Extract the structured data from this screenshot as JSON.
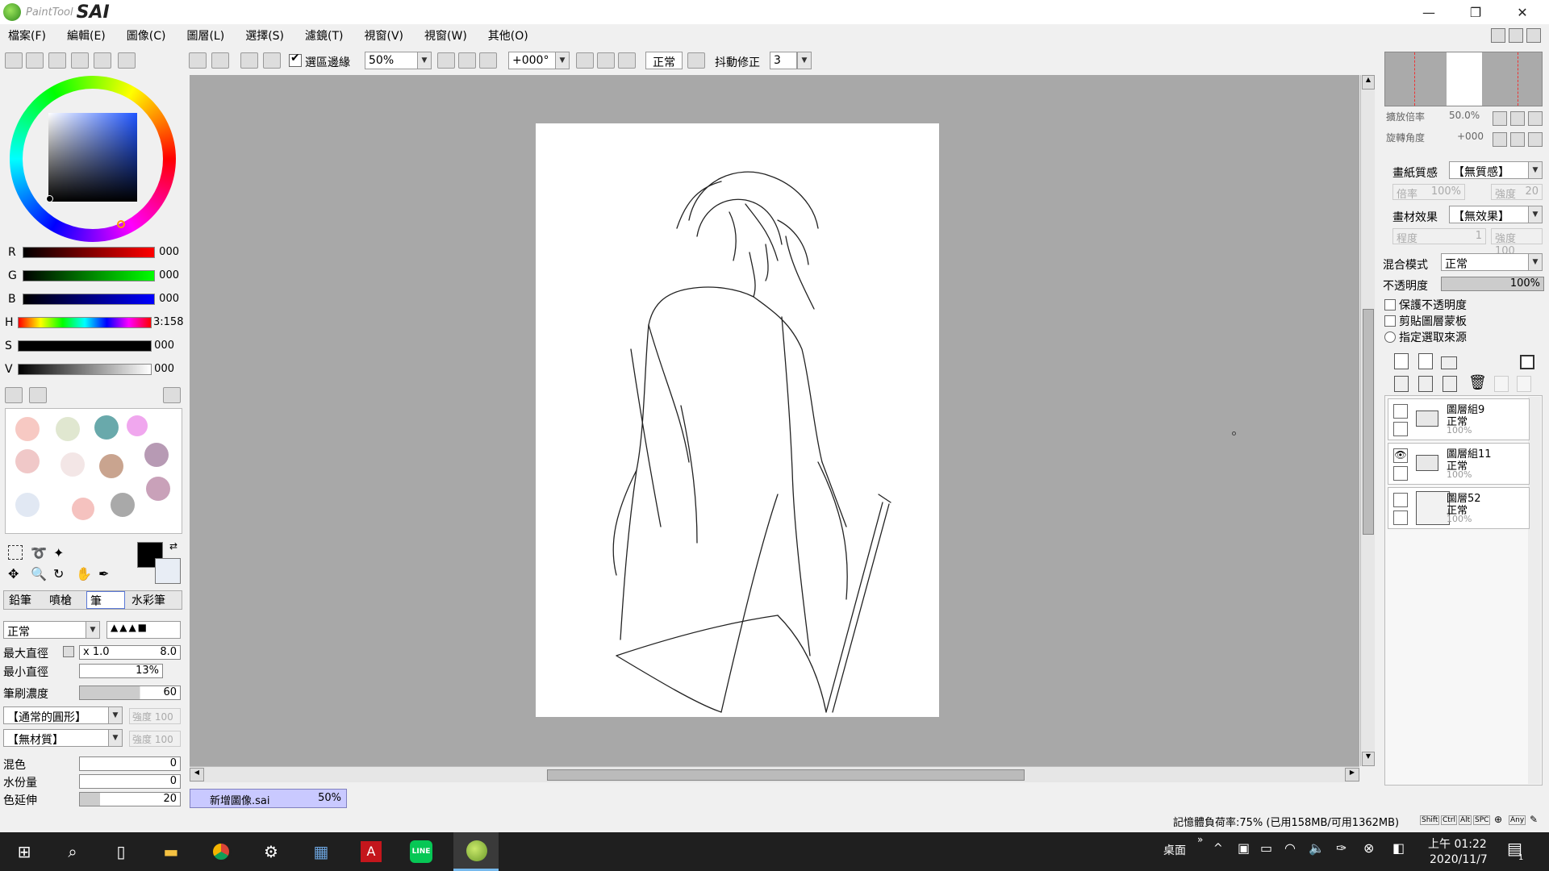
{
  "app": {
    "title_small": "PaintTool",
    "title_big": "SAI"
  },
  "window_controls": {
    "minimize": "—",
    "restore": "❐",
    "close": "✕"
  },
  "menu": [
    "檔案(F)",
    "編輯(E)",
    "圖像(C)",
    "圖層(L)",
    "選擇(S)",
    "濾鏡(T)",
    "視窗(V)",
    "視窗(W)",
    "其他(O)"
  ],
  "toolbar": {
    "selection_edge_label": "選區邊緣",
    "zoom": "50%",
    "rotation": "+000°",
    "blend_mode": "正常",
    "stabilizer_label": "抖動修正",
    "stabilizer_value": "3"
  },
  "color": {
    "r_label": "R",
    "r_value": "000",
    "g_label": "G",
    "g_value": "000",
    "b_label": "B",
    "b_value": "000",
    "h_label": "H",
    "h_value": "3:158",
    "s_label": "S",
    "s_value": "000",
    "v_label": "V",
    "v_value": "000"
  },
  "swatches": [
    "#f7c9c3",
    "#e0e7d0",
    "#69a9ab",
    "#f0a7ee",
    "#f0c8c8",
    "#f3e6e6",
    "#c9a48f",
    "#b79ab4",
    "#e1e8f3",
    "#f5c2bf",
    "#a9a9a9",
    "#c9a1b9"
  ],
  "brush_tabs": [
    "鉛筆",
    "噴槍",
    "筆",
    "水彩筆"
  ],
  "brush": {
    "blend": "正常",
    "max_size_label": "最大直徑",
    "max_size_mult": "x 1.0",
    "max_size_value": "8.0",
    "min_size_label": "最小直徑",
    "min_size_value": "13%",
    "density_label": "筆刷濃度",
    "density_value": "60",
    "shape": "【通常的圓形】",
    "shape_strength": "強度 100",
    "texture": "【無材質】",
    "texture_strength": "強度 100",
    "mix_label": "混色",
    "mix_value": "0",
    "water_label": "水份量",
    "water_value": "0",
    "stretch_label": "色延伸",
    "stretch_value": "20"
  },
  "document_tab": {
    "name": "新增圖像.sai",
    "zoom": "50%"
  },
  "navigator": {
    "zoom_label": "擴放倍率",
    "zoom_value": "50.0%",
    "rotate_label": "旋轉角度",
    "rotate_value": "+000"
  },
  "layer_props": {
    "paper_texture_label": "畫紙質感",
    "paper_texture_value": "【無質感】",
    "scale_label": "倍率",
    "scale_value": "100%",
    "strength_label": "強度",
    "strength_value": "20",
    "effect_label": "畫材效果",
    "effect_value": "【無效果】",
    "degree_label": "程度",
    "degree_value": "1",
    "effect_strength": "強度 100",
    "blend_label": "混合模式",
    "blend_value": "正常",
    "opacity_label": "不透明度",
    "opacity_value": "100%",
    "preserve_opacity": "保護不透明度",
    "clipping": "剪貼圖層蒙板",
    "selection_source": "指定選取來源"
  },
  "layers": [
    {
      "name": "圖層組9",
      "mode": "正常",
      "opacity": "100%",
      "visible": false,
      "type": "folder"
    },
    {
      "name": "圖層組11",
      "mode": "正常",
      "opacity": "100%",
      "visible": true,
      "type": "folder"
    },
    {
      "name": "圖層52",
      "mode": "正常",
      "opacity": "100%",
      "visible": false,
      "type": "layer"
    }
  ],
  "status": {
    "memory": "記憶體負荷率:75% (已用158MB/可用1362MB)",
    "keys": [
      "Shift",
      "Ctrl",
      "Alt",
      "SPC",
      "Any"
    ]
  },
  "taskbar": {
    "desktop": "桌面",
    "time": "上午 01:22",
    "date": "2020/11/7",
    "notif_count": "1"
  }
}
